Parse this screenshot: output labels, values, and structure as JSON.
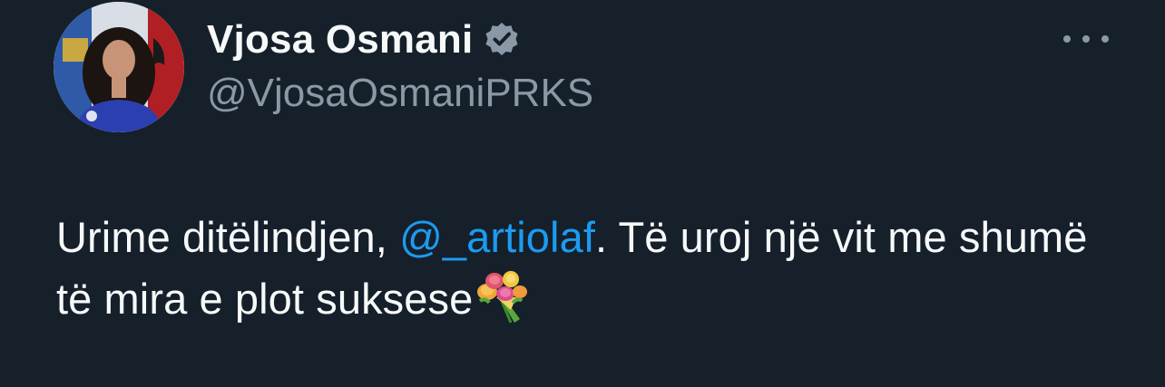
{
  "author": {
    "display_name": "Vjosa Osmani",
    "handle": "@VjosaOsmaniPRKS",
    "verified_icon": "verified-badge-icon",
    "avatar_icon": "profile-photo"
  },
  "menu": {
    "icon": "more-options-icon"
  },
  "tweet": {
    "text_before": "Urime ditëlindjen, ",
    "mention": "@_artiolaf",
    "text_after": ". Të uroj një vit me shumë të mira e plot suksese",
    "emoji_icon": "bouquet-emoji-icon"
  },
  "colors": {
    "background": "#15202b",
    "text": "#f7f9f9",
    "secondary_text": "#8b98a5",
    "link": "#1d9bf0"
  }
}
